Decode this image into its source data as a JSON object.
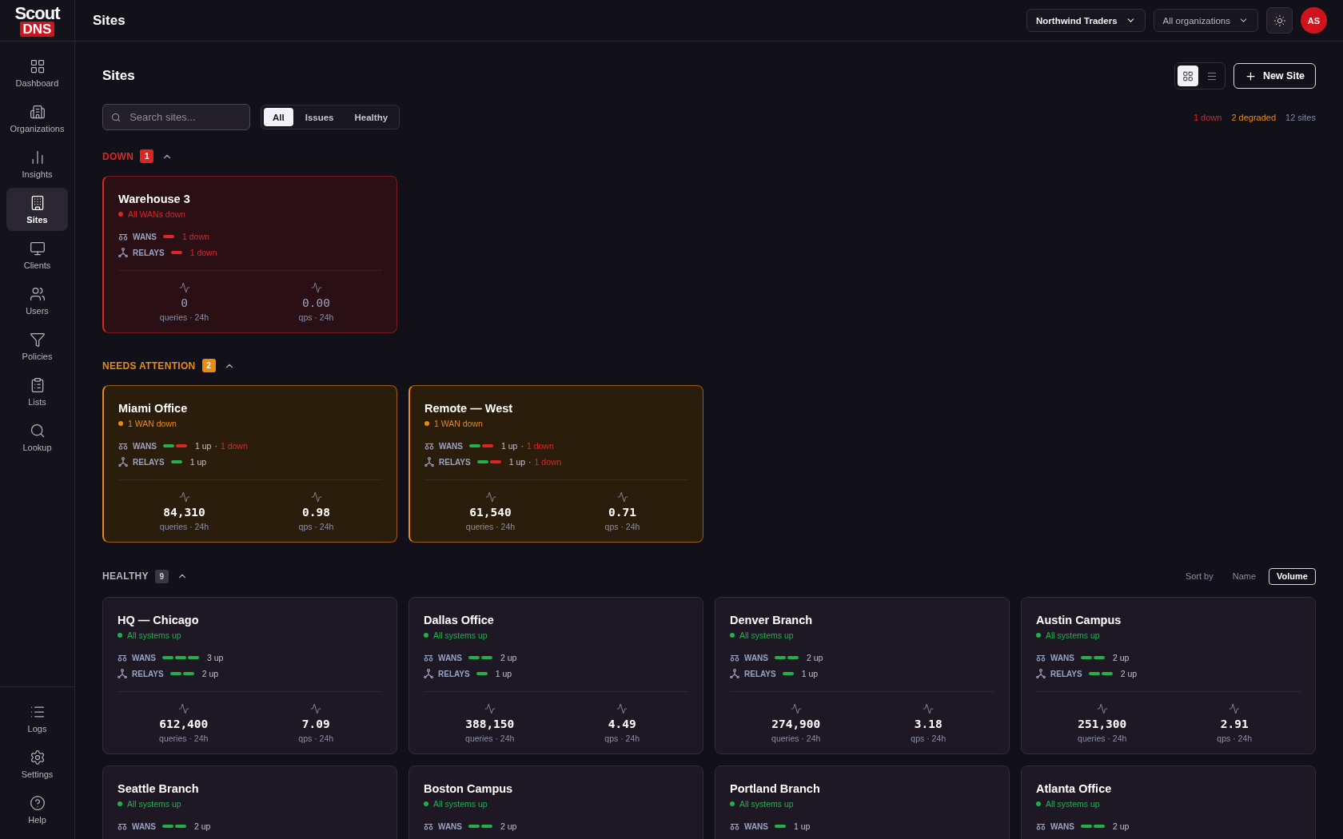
{
  "logo": {
    "top": "Scout",
    "bottom": "DNS"
  },
  "header": {
    "title": "Sites",
    "org_selector": "Northwind Traders",
    "scope_selector": "All organizations",
    "avatar": "AS"
  },
  "sidebar": {
    "items": [
      {
        "label": "Dashboard",
        "selected": false
      },
      {
        "label": "Organizations",
        "selected": false
      },
      {
        "label": "Insights",
        "selected": false
      },
      {
        "label": "Sites",
        "selected": true
      },
      {
        "label": "Clients",
        "selected": false
      },
      {
        "label": "Users",
        "selected": false
      },
      {
        "label": "Policies",
        "selected": false
      },
      {
        "label": "Lists",
        "selected": false
      },
      {
        "label": "Lookup",
        "selected": false
      }
    ],
    "bottom_items": [
      {
        "label": "Logs",
        "selected": false
      },
      {
        "label": "Settings",
        "selected": false
      },
      {
        "label": "Help",
        "selected": false
      }
    ]
  },
  "page": {
    "title": "Sites",
    "view_modes": [
      {
        "kind": "grid",
        "selected": true
      },
      {
        "kind": "list",
        "selected": false
      }
    ],
    "new_button": "New Site"
  },
  "search": {
    "placeholder": "Search sites..."
  },
  "filters": [
    {
      "label": "All",
      "selected": true
    },
    {
      "label": "Issues",
      "selected": false
    },
    {
      "label": "Healthy",
      "selected": false
    }
  ],
  "summary": [
    {
      "text": "1 down",
      "color": "#dc2626"
    },
    {
      "text": "2 degraded",
      "color": "#ea8a14"
    },
    {
      "text": "12 sites",
      "color": "#7d8db3"
    }
  ],
  "sections": [
    {
      "kind": "down",
      "title": "DOWN",
      "count": "1",
      "expanded": true,
      "sites": [
        {
          "name": "Warehouse 3",
          "kind": "down",
          "status_text": "All WANs down",
          "wans": {
            "label": "WANS",
            "segments": [
              {
                "up": false
              }
            ],
            "summary": [
              {
                "text": "1 down",
                "down": true
              }
            ]
          },
          "relays": {
            "label": "RELAYS",
            "segments": [
              {
                "up": false
              }
            ],
            "summary": [
              {
                "text": "1 down",
                "down": true
              }
            ]
          },
          "metrics": [
            {
              "value": "0",
              "label": "queries · 24h"
            },
            {
              "value": "0.00",
              "label": "qps · 24h"
            }
          ]
        }
      ]
    },
    {
      "kind": "attention",
      "title": "NEEDS ATTENTION",
      "count": "2",
      "expanded": true,
      "sites": [
        {
          "name": "Miami Office",
          "kind": "degraded",
          "status_text": "1 WAN down",
          "wans": {
            "label": "WANS",
            "segments": [
              {
                "up": true
              },
              {
                "up": false
              }
            ],
            "summary": [
              {
                "text": "1 up",
                "down": false
              },
              {
                "text": "·",
                "down": false
              },
              {
                "text": "1 down",
                "down": true
              }
            ]
          },
          "relays": {
            "label": "RELAYS",
            "segments": [
              {
                "up": true
              }
            ],
            "summary": [
              {
                "text": "1 up",
                "down": false
              }
            ]
          },
          "metrics": [
            {
              "value": "84,310",
              "label": "queries · 24h"
            },
            {
              "value": "0.98",
              "label": "qps · 24h"
            }
          ]
        },
        {
          "name": "Remote — West",
          "kind": "degraded",
          "status_text": "1 WAN down",
          "wans": {
            "label": "WANS",
            "segments": [
              {
                "up": true
              },
              {
                "up": false
              }
            ],
            "summary": [
              {
                "text": "1 up",
                "down": false
              },
              {
                "text": "·",
                "down": false
              },
              {
                "text": "1 down",
                "down": true
              }
            ]
          },
          "relays": {
            "label": "RELAYS",
            "segments": [
              {
                "up": true
              },
              {
                "up": false
              }
            ],
            "summary": [
              {
                "text": "1 up",
                "down": false
              },
              {
                "text": "·",
                "down": false
              },
              {
                "text": "1 down",
                "down": true
              }
            ]
          },
          "metrics": [
            {
              "value": "61,540",
              "label": "queries · 24h"
            },
            {
              "value": "0.71",
              "label": "qps · 24h"
            }
          ]
        }
      ]
    },
    {
      "kind": "healthy",
      "title": "HEALTHY",
      "count": "9",
      "expanded": true,
      "sort": {
        "label": "Sort by",
        "options": [
          {
            "label": "Name",
            "selected": false
          },
          {
            "label": "Volume",
            "selected": true
          }
        ]
      },
      "sites": [
        {
          "name": "HQ — Chicago",
          "kind": "healthy",
          "status_text": "All systems up",
          "wans": {
            "label": "WANS",
            "segments": [
              {
                "up": true
              },
              {
                "up": true
              },
              {
                "up": true
              }
            ],
            "summary": [
              {
                "text": "3 up",
                "down": false
              }
            ]
          },
          "relays": {
            "label": "RELAYS",
            "segments": [
              {
                "up": true
              },
              {
                "up": true
              }
            ],
            "summary": [
              {
                "text": "2 up",
                "down": false
              }
            ]
          },
          "metrics": [
            {
              "value": "612,400",
              "label": "queries · 24h"
            },
            {
              "value": "7.09",
              "label": "qps · 24h"
            }
          ]
        },
        {
          "name": "Dallas Office",
          "kind": "healthy",
          "status_text": "All systems up",
          "wans": {
            "label": "WANS",
            "segments": [
              {
                "up": true
              },
              {
                "up": true
              }
            ],
            "summary": [
              {
                "text": "2 up",
                "down": false
              }
            ]
          },
          "relays": {
            "label": "RELAYS",
            "segments": [
              {
                "up": true
              }
            ],
            "summary": [
              {
                "text": "1 up",
                "down": false
              }
            ]
          },
          "metrics": [
            {
              "value": "388,150",
              "label": "queries · 24h"
            },
            {
              "value": "4.49",
              "label": "qps · 24h"
            }
          ]
        },
        {
          "name": "Denver Branch",
          "kind": "healthy",
          "status_text": "All systems up",
          "wans": {
            "label": "WANS",
            "segments": [
              {
                "up": true
              },
              {
                "up": true
              }
            ],
            "summary": [
              {
                "text": "2 up",
                "down": false
              }
            ]
          },
          "relays": {
            "label": "RELAYS",
            "segments": [
              {
                "up": true
              }
            ],
            "summary": [
              {
                "text": "1 up",
                "down": false
              }
            ]
          },
          "metrics": [
            {
              "value": "274,900",
              "label": "queries · 24h"
            },
            {
              "value": "3.18",
              "label": "qps · 24h"
            }
          ]
        },
        {
          "name": "Austin Campus",
          "kind": "healthy",
          "status_text": "All systems up",
          "wans": {
            "label": "WANS",
            "segments": [
              {
                "up": true
              },
              {
                "up": true
              }
            ],
            "summary": [
              {
                "text": "2 up",
                "down": false
              }
            ]
          },
          "relays": {
            "label": "RELAYS",
            "segments": [
              {
                "up": true
              },
              {
                "up": true
              }
            ],
            "summary": [
              {
                "text": "2 up",
                "down": false
              }
            ]
          },
          "metrics": [
            {
              "value": "251,300",
              "label": "queries · 24h"
            },
            {
              "value": "2.91",
              "label": "qps · 24h"
            }
          ]
        },
        {
          "name": "Seattle Branch",
          "kind": "healthy",
          "status_text": "All systems up",
          "wans": {
            "label": "WANS",
            "segments": [
              {
                "up": true
              },
              {
                "up": true
              }
            ],
            "summary": [
              {
                "text": "2 up",
                "down": false
              }
            ]
          }
        },
        {
          "name": "Boston Campus",
          "kind": "healthy",
          "status_text": "All systems up",
          "wans": {
            "label": "WANS",
            "segments": [
              {
                "up": true
              },
              {
                "up": true
              }
            ],
            "summary": [
              {
                "text": "2 up",
                "down": false
              }
            ]
          }
        },
        {
          "name": "Portland Branch",
          "kind": "healthy",
          "status_text": "All systems up",
          "wans": {
            "label": "WANS",
            "segments": [
              {
                "up": true
              }
            ],
            "summary": [
              {
                "text": "1 up",
                "down": false
              }
            ]
          }
        },
        {
          "name": "Atlanta Office",
          "kind": "healthy",
          "status_text": "All systems up",
          "wans": {
            "label": "WANS",
            "segments": [
              {
                "up": true
              },
              {
                "up": true
              }
            ],
            "summary": [
              {
                "text": "2 up",
                "down": false
              }
            ]
          }
        }
      ]
    }
  ]
}
